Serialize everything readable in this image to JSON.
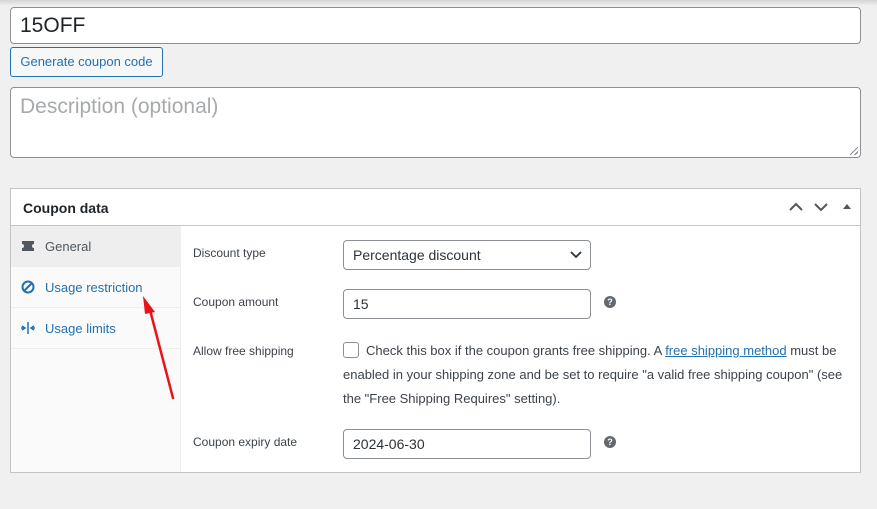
{
  "coupon_code": "15OFF",
  "generate_button": "Generate coupon code",
  "description_placeholder": "Description (optional)",
  "panel": {
    "title": "Coupon data",
    "tabs": [
      {
        "label": "General",
        "icon": "ticket-icon",
        "active": true
      },
      {
        "label": "Usage restriction",
        "icon": "restricted-icon",
        "active": false
      },
      {
        "label": "Usage limits",
        "icon": "limits-icon",
        "active": false
      }
    ]
  },
  "fields": {
    "discount_type": {
      "label": "Discount type",
      "value": "Percentage discount"
    },
    "coupon_amount": {
      "label": "Coupon amount",
      "value": "15"
    },
    "free_shipping": {
      "label": "Allow free shipping",
      "checked": false,
      "text_before": "Check this box if the coupon grants free shipping. A ",
      "link": "free shipping method",
      "text_after": " must be enabled in your shipping zone and be set to require \"a valid free shipping coupon\" (see the \"Free Shipping Requires\" setting)."
    },
    "expiry_date": {
      "label": "Coupon expiry date",
      "value": "2024-06-30"
    }
  },
  "colors": {
    "accent": "#2271b1",
    "annotation_arrow": "#e8141b"
  }
}
